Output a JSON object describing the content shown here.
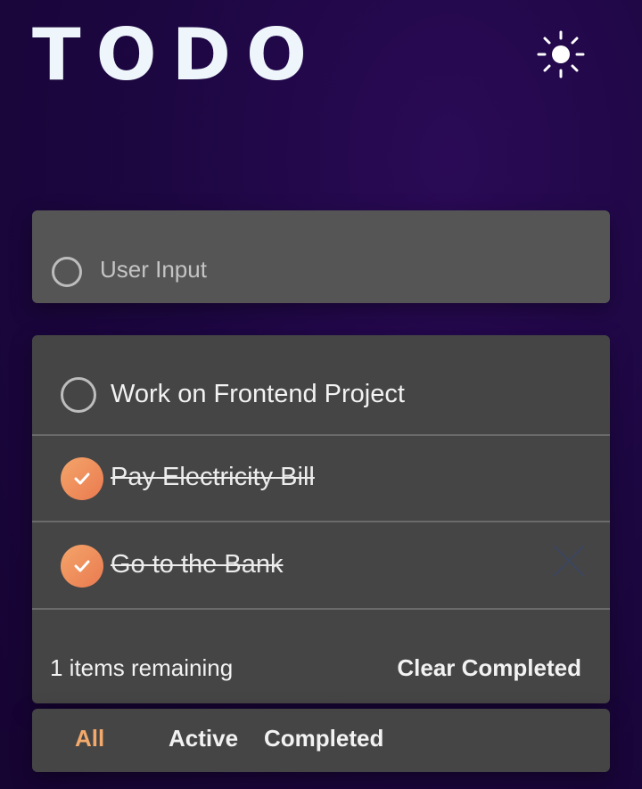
{
  "header": {
    "title": "TODO",
    "theme_icon": "sun-icon"
  },
  "input": {
    "placeholder": "User Input",
    "value": ""
  },
  "todos": [
    {
      "text": "Work on Frontend Project",
      "completed": false
    },
    {
      "text": "Pay Electricity Bill",
      "completed": true
    },
    {
      "text": "Go to the Bank",
      "completed": true
    }
  ],
  "footer": {
    "items_remaining": "1 items remaining",
    "clear_label": "Clear Completed"
  },
  "filters": {
    "all": "All",
    "active": "Active",
    "completed": "Completed",
    "selected": "All"
  },
  "colors": {
    "accent": "#f3a96b",
    "check_gradient_start": "#f4a56a",
    "check_gradient_end": "#ea7a50",
    "background": "#1d0742",
    "card": "#454545",
    "input_card": "#555555"
  }
}
